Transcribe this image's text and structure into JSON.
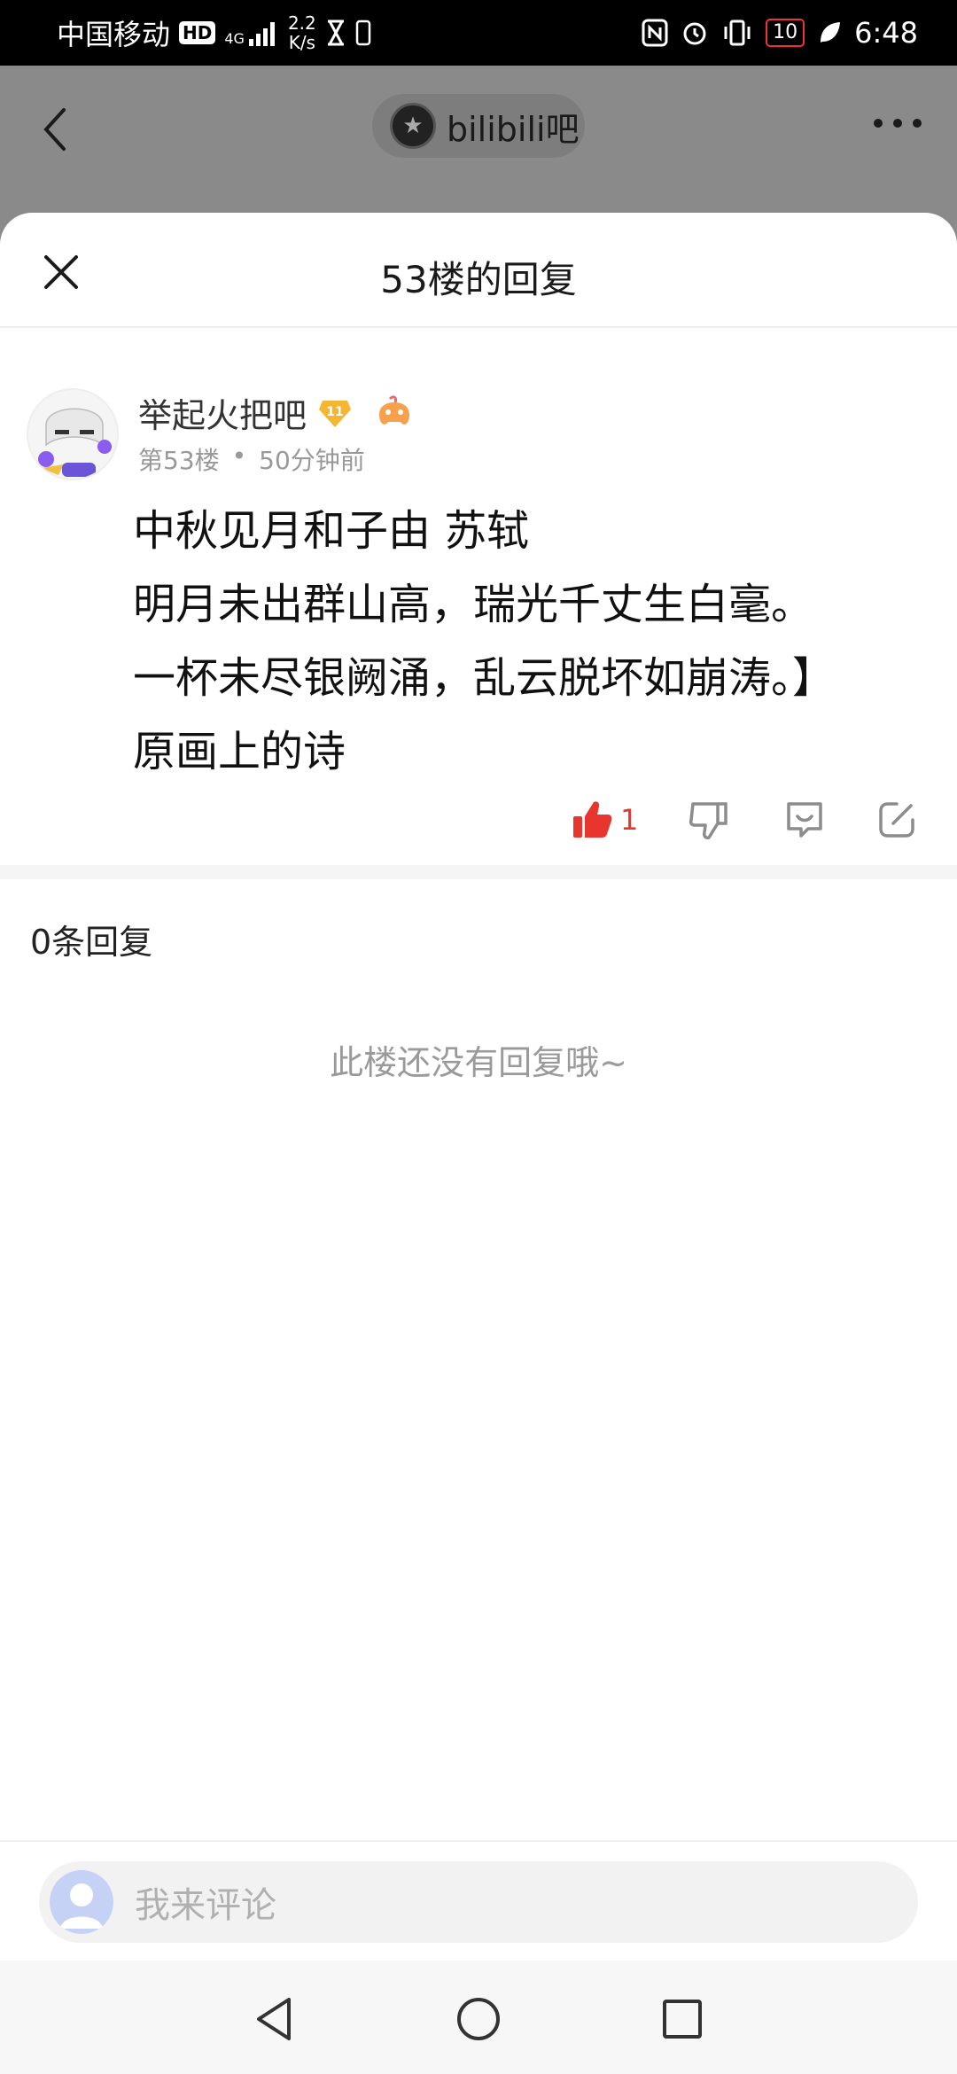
{
  "status_bar": {
    "carrier": "中国移动",
    "hd": "HD",
    "network": "4G",
    "net_speed_value": "2.2",
    "net_speed_unit": "K/s",
    "battery": "10",
    "time": "6:48"
  },
  "background": {
    "forum_name": "bilibili吧"
  },
  "sheet": {
    "title": "53楼的回复"
  },
  "post": {
    "username": "举起火把吧",
    "level": "11",
    "floor": "第53楼",
    "separator": "•",
    "time_ago": "50分钟前",
    "content": "中秋见月和子由 苏轼\n明月未出群山高，瑞光千丈生白毫。\n一杯未尽银阙涌，乱云脱坏如崩涛。】\n原画上的诗",
    "like_count": "1"
  },
  "replies": {
    "count_label": "0条回复",
    "empty_text": "此楼还没有回复哦~"
  },
  "comment_bar": {
    "placeholder": "我来评论"
  },
  "colors": {
    "like_red": "#e8352e",
    "muted_text": "#9a9a9a",
    "overlay": "#8a8a8a"
  },
  "icons": [
    "back-icon",
    "more-icon",
    "close-icon",
    "like-icon",
    "dislike-icon",
    "reply-icon",
    "share-icon",
    "nav-back-icon",
    "nav-home-icon",
    "nav-recents-icon"
  ]
}
